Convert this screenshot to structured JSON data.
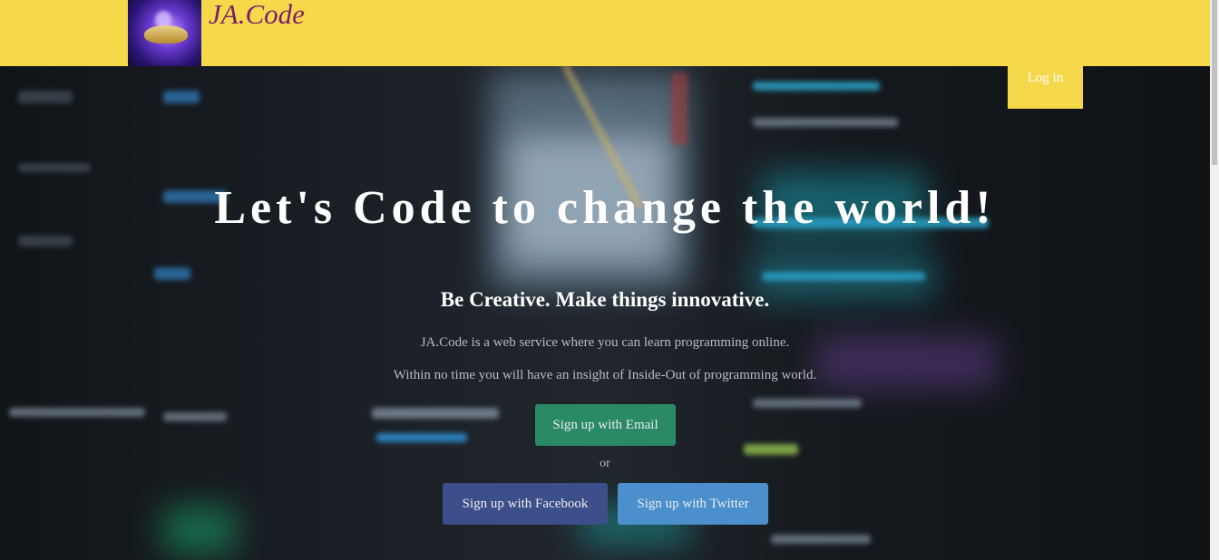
{
  "header": {
    "brand": "JA.Code",
    "login_label": "Log in",
    "accent_color": "#f6d94a"
  },
  "hero": {
    "title": "Let's Code to change the world!",
    "tagline": "Be Creative. Make things innovative.",
    "description_1": "JA.Code is a web service where you can learn programming online.",
    "description_2": "Within no time you will have an insight of Inside-Out of programming world.",
    "signup_email_label": "Sign up with Email",
    "or_label": "or",
    "signup_facebook_label": "Sign up with Facebook",
    "signup_twitter_label": "Sign up with Twitter"
  },
  "colors": {
    "email_button": "#2a8a66",
    "facebook_button": "#3d4f8a",
    "twitter_button": "#4b8fcc"
  }
}
